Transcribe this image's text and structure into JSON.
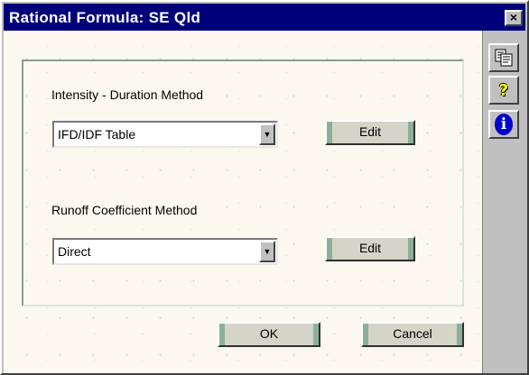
{
  "window": {
    "title": "Rational Formula: SE Qld",
    "close_glyph": "×"
  },
  "intensity": {
    "label": "Intensity - Duration Method",
    "selected": "IFD/IDF Table",
    "edit_label": "Edit"
  },
  "runoff": {
    "label": "Runoff Coefficient Method",
    "selected": "Direct",
    "edit_label": "Edit"
  },
  "footer": {
    "ok_label": "OK",
    "cancel_label": "Cancel"
  },
  "toolbar": {
    "icons": [
      "copy-icon",
      "help-icon",
      "info-icon"
    ],
    "help_glyph": "?",
    "info_glyph": "i"
  },
  "colors": {
    "titlebar": "#00007b",
    "client_bg": "#fbf9ef",
    "button_accent": "#8bb09a",
    "help_yellow": "#ffff00",
    "info_blue": "#0000c8"
  }
}
